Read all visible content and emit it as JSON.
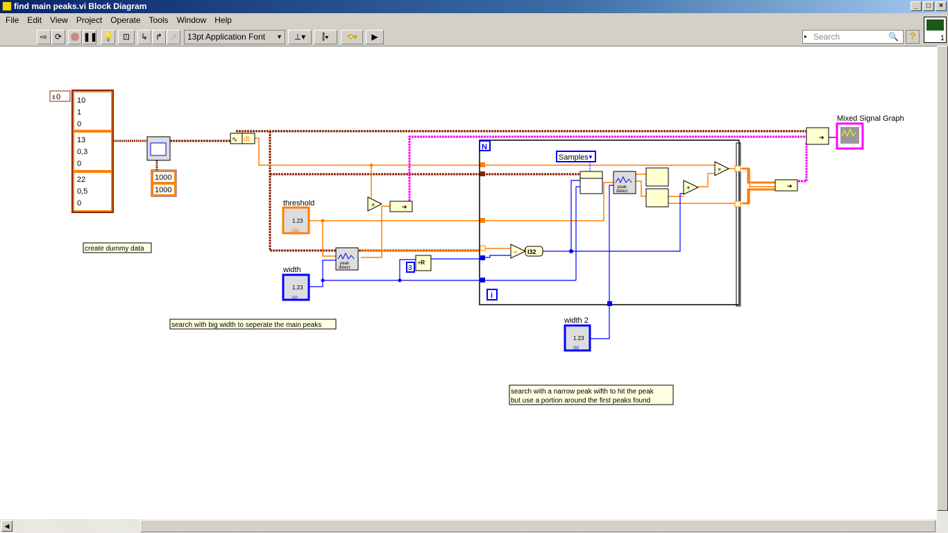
{
  "window": {
    "title": "find main peaks.vi Block Diagram"
  },
  "menu": [
    "File",
    "Edit",
    "View",
    "Project",
    "Operate",
    "Tools",
    "Window",
    "Help"
  ],
  "toolbar": {
    "font": "13pt Application Font",
    "search_placeholder": "Search",
    "help": "?",
    "vi_icon_number": "1"
  },
  "diagram": {
    "array_index": "0",
    "clusters": [
      [
        "10",
        "1",
        "0"
      ],
      [
        "13",
        "0,3",
        "0"
      ],
      [
        "22",
        "0,5",
        "0"
      ]
    ],
    "samples_constants": [
      "1000",
      "1000"
    ],
    "dt_label": "dt",
    "threshold_label": "threshold",
    "threshold_value": "1.23",
    "threshold_type": "DBL",
    "width_label": "width",
    "width_value": "1.23",
    "width_type": "I32",
    "width2_label": "width 2",
    "width2_value": "1.23",
    "width2_type": "I32",
    "graph_label": "Mixed Signal Graph",
    "samples_enum": "Samples",
    "loop_count": "N",
    "loop_index": "i",
    "const_three": "3",
    "i32_label": "I32",
    "peak_detect_label": [
      "peak",
      "detect"
    ],
    "ops": {
      "multiply": "×",
      "subtract": "−",
      "add": "+"
    },
    "comments": [
      "create dummy data",
      "search with big width to seperate the main peaks",
      "search with a narrow peak wifth to hit the peak",
      "but use a portion around the first peaks found"
    ]
  },
  "colors": {
    "dbl": "#ff7f00",
    "int": "#0000ff",
    "waveform": "#8b2500",
    "mixed": "#ff00ff",
    "comment_bg": "#ffffe1"
  }
}
